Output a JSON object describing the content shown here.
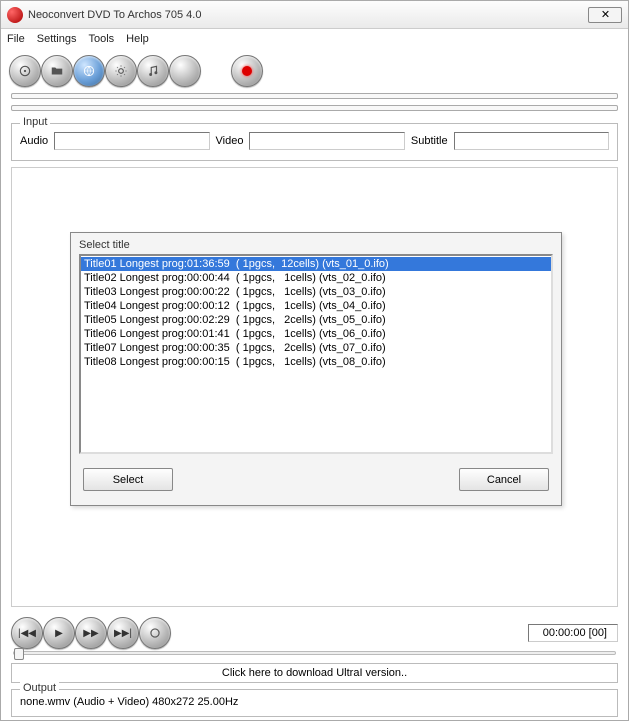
{
  "window": {
    "title": "Neoconvert DVD To Archos 705 4.0",
    "close_glyph": "✕"
  },
  "menu": {
    "file": "File",
    "settings": "Settings",
    "tools": "Tools",
    "help": "Help"
  },
  "input": {
    "legend": "Input",
    "audio_label": "Audio",
    "video_label": "Video",
    "subtitle_label": "Subtitle",
    "audio_value": "",
    "video_value": "",
    "subtitle_value": ""
  },
  "dialog": {
    "title": "Select title",
    "titles": [
      "Title01 Longest prog:01:36:59  ( 1pgcs,  12cells) (vts_01_0.ifo)",
      "Title02 Longest prog:00:00:44  ( 1pgcs,   1cells) (vts_02_0.ifo)",
      "Title03 Longest prog:00:00:22  ( 1pgcs,   1cells) (vts_03_0.ifo)",
      "Title04 Longest prog:00:00:12  ( 1pgcs,   1cells) (vts_04_0.ifo)",
      "Title05 Longest prog:00:02:29  ( 1pgcs,   2cells) (vts_05_0.ifo)",
      "Title06 Longest prog:00:01:41  ( 1pgcs,   1cells) (vts_06_0.ifo)",
      "Title07 Longest prog:00:00:35  ( 1pgcs,   2cells) (vts_07_0.ifo)",
      "Title08 Longest prog:00:00:15  ( 1pgcs,   1cells) (vts_08_0.ifo)"
    ],
    "selected_index": 0,
    "select_label": "Select",
    "cancel_label": "Cancel"
  },
  "playback": {
    "timecode": "00:00:00 [00]"
  },
  "download": {
    "label": "Click here to download UltraI version.."
  },
  "output": {
    "legend": "Output",
    "value": "none.wmv (Audio + Video) 480x272 25.00Hz"
  }
}
